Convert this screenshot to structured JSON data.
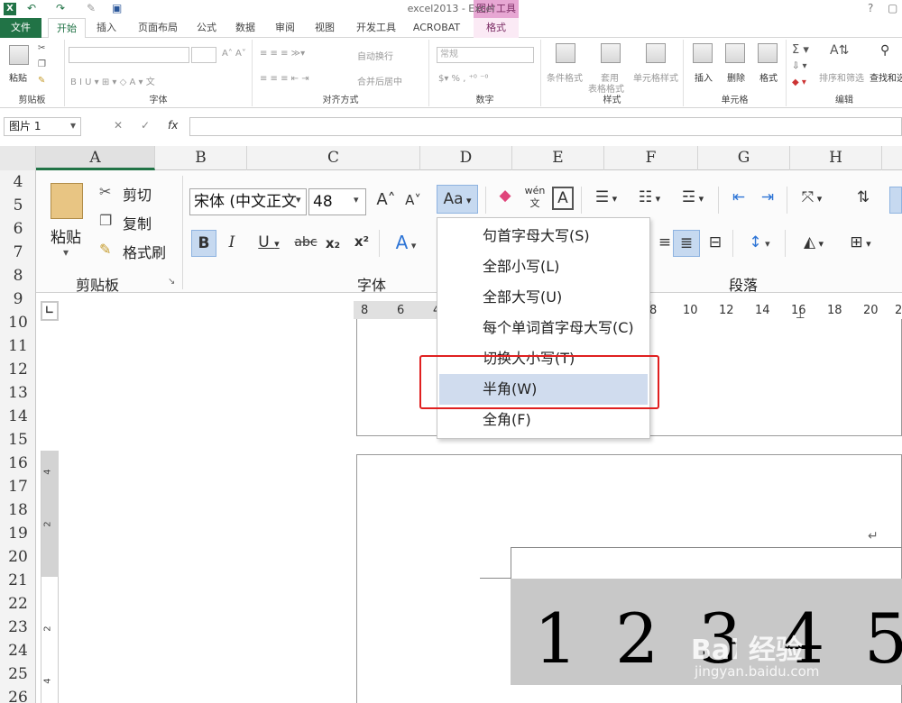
{
  "window": {
    "title": "excel2013 - Excel",
    "context_tab_group": "图片工具",
    "help": "?"
  },
  "excel_tabs": {
    "file": "文件",
    "items": [
      "开始",
      "插入",
      "页面布局",
      "公式",
      "数据",
      "审阅",
      "视图",
      "开发工具",
      "ACROBAT"
    ],
    "context": "格式"
  },
  "excel_ribbon": {
    "clipboard": {
      "paste": "粘贴",
      "label": "剪贴板"
    },
    "font": {
      "label": "字体"
    },
    "alignment": {
      "wrap": "自动换行",
      "merge": "合并后居中",
      "label": "对齐方式"
    },
    "number": {
      "format": "常规",
      "label": "数字"
    },
    "styles": {
      "cond": "条件格式",
      "table1": "套用",
      "table2": "表格格式",
      "cell": "单元格样式",
      "label": "样式"
    },
    "cells": {
      "insert": "插入",
      "delete": "删除",
      "format": "格式",
      "label": "单元格"
    },
    "editing": {
      "sort": "排序和筛选",
      "find": "查找和选",
      "label": "编辑"
    }
  },
  "formula_bar": {
    "name_box": "图片 1",
    "fx": "fx",
    "cancel": "✕",
    "enter": "✓"
  },
  "columns": [
    "A",
    "B",
    "C",
    "D",
    "E",
    "F",
    "G",
    "H"
  ],
  "rows": [
    "4",
    "5",
    "6",
    "7",
    "8",
    "9",
    "10",
    "11",
    "12",
    "13",
    "14",
    "15",
    "16",
    "17",
    "18",
    "19",
    "20",
    "21",
    "22",
    "23",
    "24",
    "25",
    "26"
  ],
  "word_ribbon": {
    "clipboard": {
      "paste": "粘贴",
      "cut": "剪切",
      "copy": "复制",
      "format_painter": "格式刷",
      "label": "剪贴板"
    },
    "font": {
      "name": "宋体 (中文正文",
      "size": "48",
      "label": "字体",
      "case_button": "Aa"
    },
    "paragraph": {
      "label": "段落"
    }
  },
  "case_menu": {
    "items": [
      {
        "label": "句首字母大写(S)"
      },
      {
        "label": "全部小写(L)"
      },
      {
        "label": "全部大写(U)"
      },
      {
        "label": "每个单词首字母大写(C)"
      },
      {
        "label": "切换大小写(T)"
      },
      {
        "label": "半角(W)"
      },
      {
        "label": "全角(F)"
      }
    ],
    "highlighted_index": 5
  },
  "hruler_ticks": [
    "8",
    "6",
    "4",
    "8",
    "10",
    "12",
    "14",
    "16",
    "18",
    "20",
    "2"
  ],
  "vruler_ticks": [
    "4",
    "2",
    "2",
    "4"
  ],
  "document": {
    "numbers": [
      "1",
      "2",
      "3",
      "4",
      "5"
    ],
    "return_mark": "↵"
  },
  "watermark": {
    "brand": "Bai 经验",
    "url": "jingyan.baidu.com"
  },
  "colors": {
    "excel_green": "#217346",
    "highlight": "#d0dcee",
    "annotation_red": "#e02020"
  }
}
